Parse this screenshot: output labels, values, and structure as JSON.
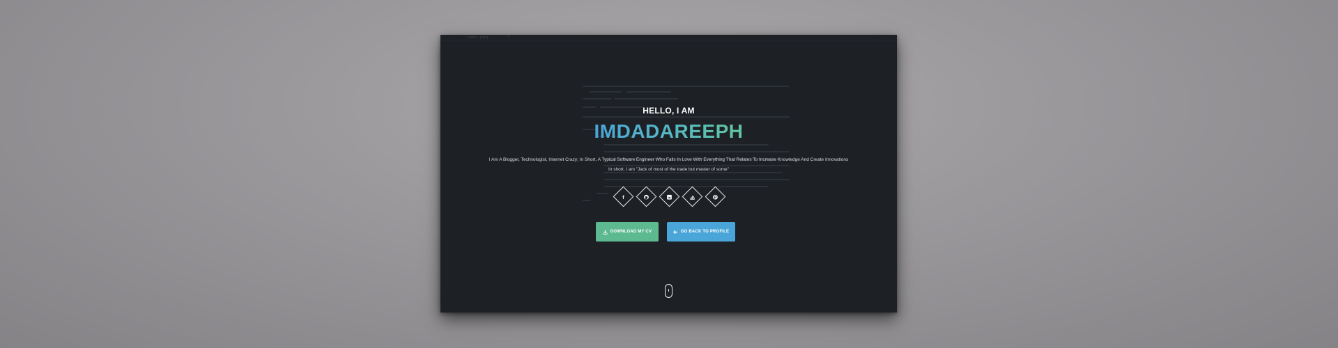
{
  "window": {
    "tab_label": "index.java",
    "tab_close": "×"
  },
  "hero": {
    "greeting": "HELLO, I AM",
    "name": "IMDADAREEPH",
    "tagline": "I Am A Blogger, Technologist, Internet Crazy; In Short, A Typical Software Engineer Who Falls In Love With Everything That Relates To Increase Knowledge And Create Innovations",
    "tagline2": "In short, I am \"Jack of most of the trade but master of some\""
  },
  "socials": [
    {
      "icon": "facebook-icon",
      "glyph": "f"
    },
    {
      "icon": "github-icon",
      "glyph": ""
    },
    {
      "icon": "linkedin-icon",
      "glyph": "in"
    },
    {
      "icon": "stack-overflow-icon",
      "glyph": ""
    },
    {
      "icon": "pinterest-icon",
      "glyph": ""
    }
  ],
  "buttons": {
    "download_cv": "DOWNLOAD MY CV",
    "back_to_profile": "GO BACK TO PROFILE"
  },
  "colors": {
    "frame_background": "#1d2126",
    "name_gradient_start": "#4aa6d8",
    "name_gradient_end": "#62c49f",
    "download_button": "#5cb990",
    "profile_button": "#4aa6d8"
  }
}
